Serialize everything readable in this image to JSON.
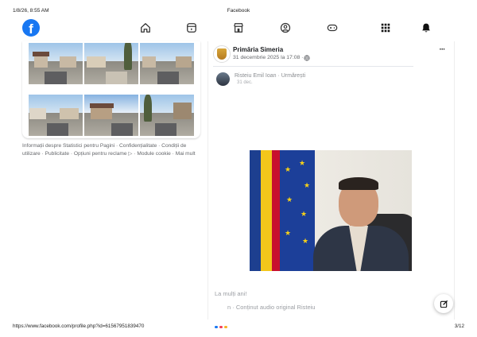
{
  "print": {
    "date": "1/8/26, 8:55 AM",
    "title": "Facebook",
    "url": "https://www.facebook.com/profile.php?id=61567951839470",
    "page": "3/12"
  },
  "nav": {
    "logo_letter": "f",
    "icons": [
      "home-icon",
      "reels-icon",
      "marketplace-icon",
      "groups-icon",
      "gaming-icon",
      "menu-grid-icon",
      "notifications-bell-icon"
    ]
  },
  "footer_links": "Informații despre Statistici pentru Pagini · Confidențialitate · Condiții de utilizare · Publicitate · Opțiuni pentru reclame ▷ · Module cookie · Mai mult",
  "post": {
    "page_name": "Primăria Simeria",
    "date": "31 decembrie 2025 la 17:08 ·",
    "commenter": "Risteiu Emil Ioan · Urmărești",
    "comment_date": "31 dec.",
    "caption": "La mulți ani!",
    "audio_line": "n · Conținut audio original     Risteiu"
  },
  "colors": {
    "brand": "#1877f2",
    "ro_blue": "#1d3f8f",
    "ro_yellow": "#f3c61b",
    "ro_red": "#c8102e",
    "eu_blue": "#1c3f99"
  }
}
